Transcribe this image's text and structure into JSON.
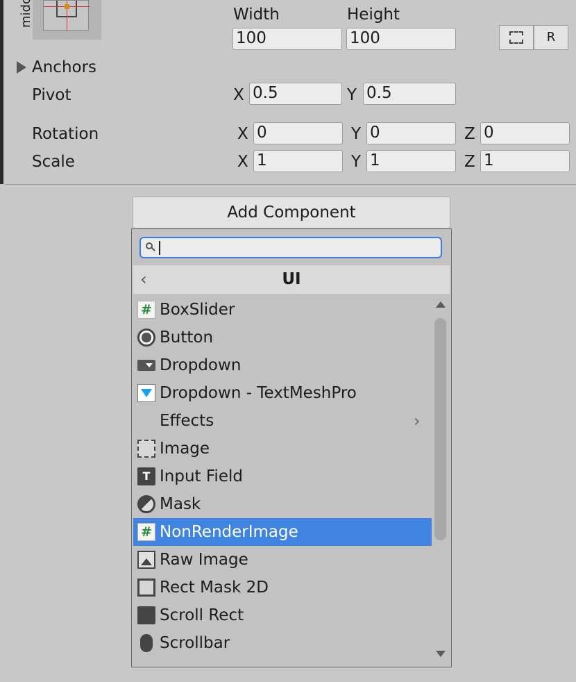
{
  "transform": {
    "anchor_preset_label": "midc",
    "width_label": "Width",
    "height_label": "Height",
    "width": "100",
    "height": "100",
    "blueprint_icon": "dashed-rect-icon",
    "raw_edit_icon": "R",
    "anchors_label": "Anchors",
    "pivot_label": "Pivot",
    "pivot_x": "0.5",
    "pivot_y": "0.5",
    "rotation_label": "Rotation",
    "rotation_x": "0",
    "rotation_y": "0",
    "rotation_z": "0",
    "scale_label": "Scale",
    "scale_x": "1",
    "scale_y": "1",
    "scale_z": "1",
    "axis_x": "X",
    "axis_y": "Y",
    "axis_z": "Z"
  },
  "add_component": {
    "button_label": "Add Component",
    "search_value": "",
    "category_title": "UI",
    "items": [
      {
        "label": "BoxSlider",
        "icon": "script-icon"
      },
      {
        "label": "Button",
        "icon": "button-icon"
      },
      {
        "label": "Dropdown",
        "icon": "dropdown-icon"
      },
      {
        "label": "Dropdown - TextMeshPro",
        "icon": "dropdown-tmp-icon"
      },
      {
        "label": "Effects",
        "icon": "folder-submenu"
      },
      {
        "label": "Image",
        "icon": "image-icon"
      },
      {
        "label": "Input Field",
        "icon": "input-field-icon"
      },
      {
        "label": "Mask",
        "icon": "mask-icon"
      },
      {
        "label": "NonRenderImage",
        "icon": "script-icon",
        "selected": true
      },
      {
        "label": "Raw Image",
        "icon": "raw-image-icon"
      },
      {
        "label": "Rect Mask 2D",
        "icon": "rect-mask-icon"
      },
      {
        "label": "Scroll Rect",
        "icon": "scroll-rect-icon"
      },
      {
        "label": "Scrollbar",
        "icon": "scrollbar-icon"
      }
    ]
  }
}
